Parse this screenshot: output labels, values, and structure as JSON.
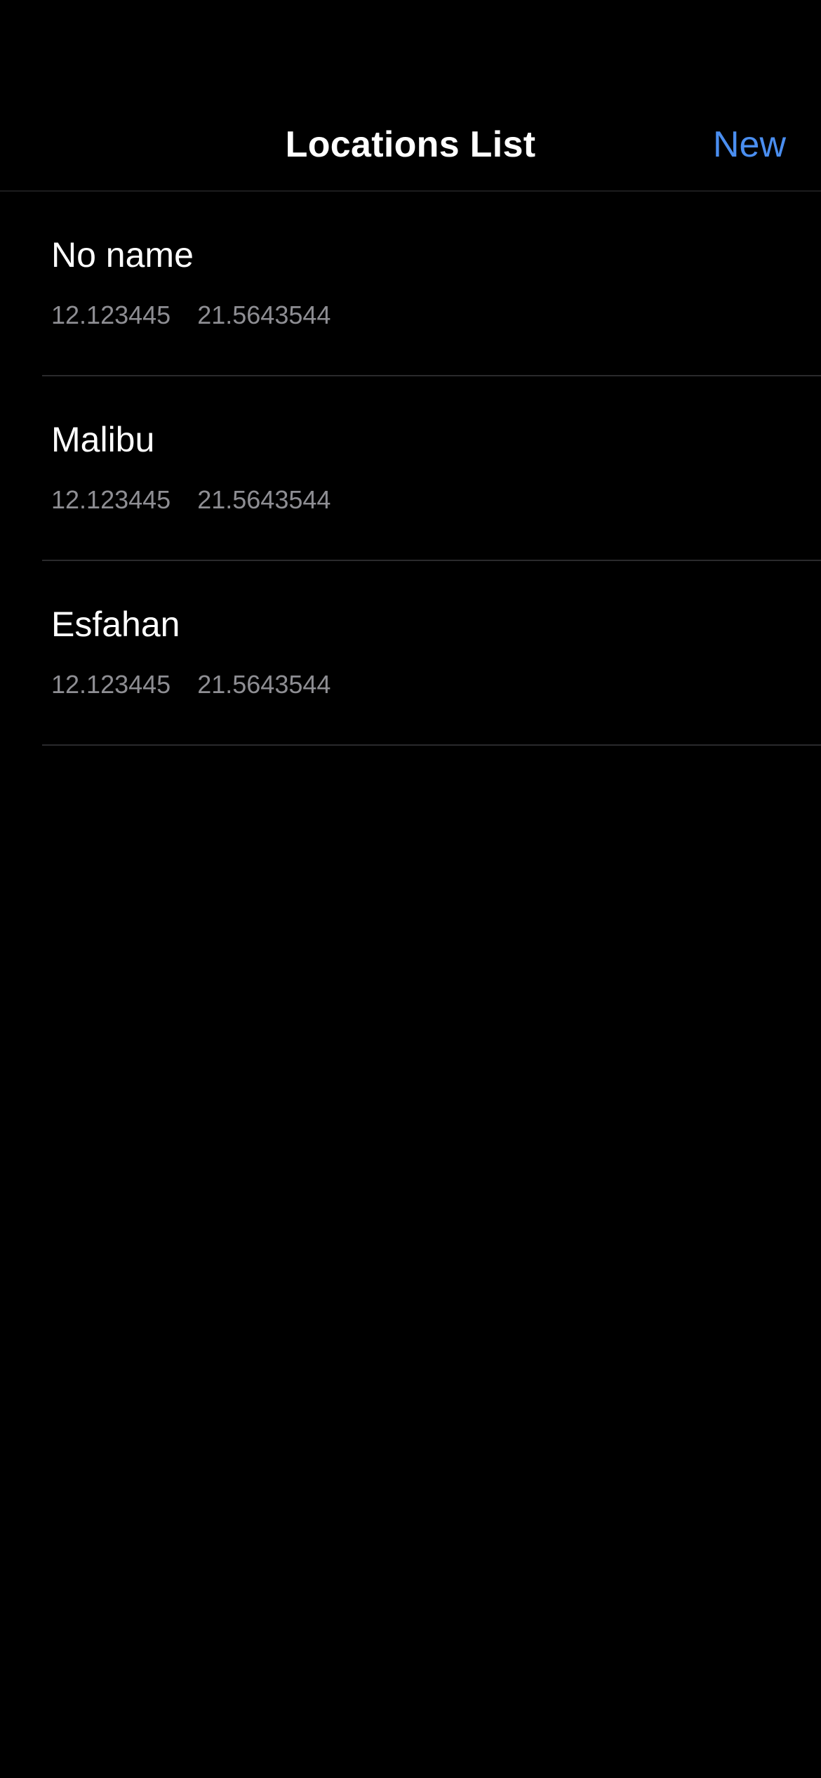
{
  "nav": {
    "title": "Locations List",
    "new_label": "New",
    "accent_color": "#4a8ef0"
  },
  "locations": [
    {
      "name": "No name",
      "latitude": "12.123445",
      "longitude": "21.5643544"
    },
    {
      "name": "Malibu",
      "latitude": "12.123445",
      "longitude": "21.5643544"
    },
    {
      "name": "Esfahan",
      "latitude": "12.123445",
      "longitude": "21.5643544"
    }
  ]
}
